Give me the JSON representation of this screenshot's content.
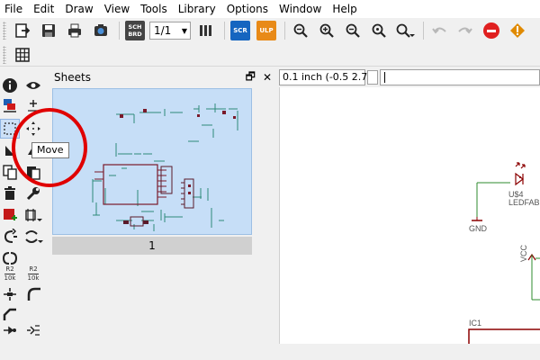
{
  "menu": [
    "File",
    "Edit",
    "Draw",
    "View",
    "Tools",
    "Library",
    "Options",
    "Window",
    "Help"
  ],
  "toolbar": {
    "page_select_value": "1/1",
    "sch_brd_top": "SCH",
    "sch_brd_bottom": "BRD",
    "sch_label": "SCR",
    "ulp_label": "ULP"
  },
  "sheets_panel": {
    "title": "Sheets",
    "restore_glyph": "🗗",
    "close_glyph": "✕",
    "sheet_label": "1"
  },
  "command_bar": {
    "coordinate_text": "0.1 inch (-0.5 2.7)",
    "command_value": ""
  },
  "palette": {
    "resistor_name_top": "R2",
    "resistor_name_bottom": "10k",
    "resistor_value_top": "R2",
    "resistor_value_bottom": "10k"
  },
  "tooltip": {
    "text": "Move"
  },
  "schematic": {
    "led_name": "U$4",
    "led_value": "LEDFAB",
    "gnd_label": "GND",
    "vcc_label": "VCC",
    "ic_label": "IC1"
  },
  "colors": {
    "selection_fill": "#c6def7",
    "annotation_red": "#e00000",
    "schematic_wire": "#2e8b2e",
    "schematic_part": "#8b0000"
  }
}
